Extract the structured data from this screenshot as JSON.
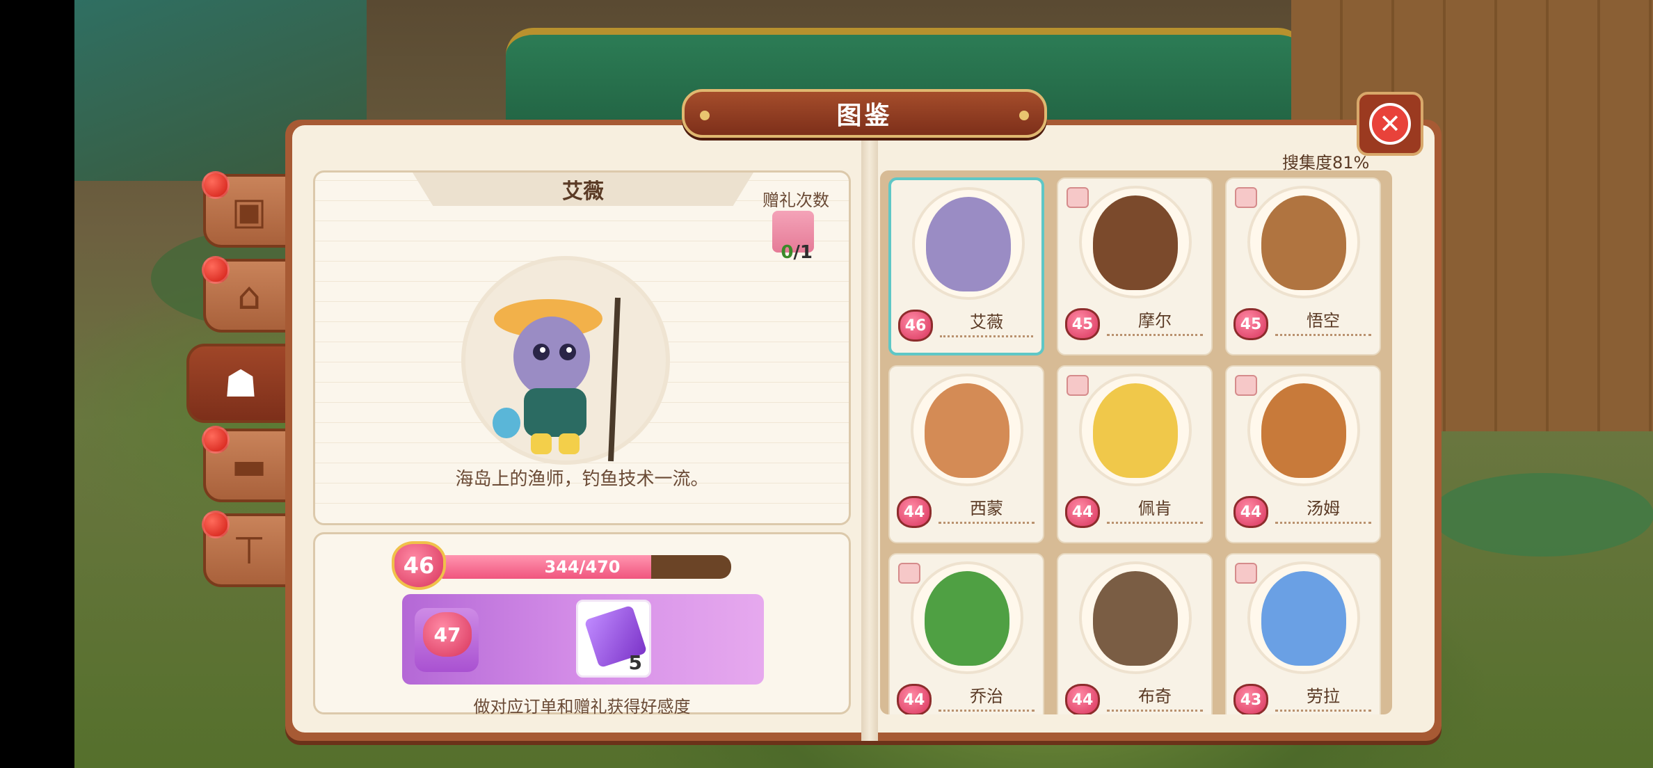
{
  "title": "图鉴",
  "close_icon": "close-icon",
  "side_tabs": [
    {
      "icon": "box-icon",
      "glyph": "▣",
      "badge": true
    },
    {
      "icon": "house-icon",
      "glyph": "⌂",
      "badge": true
    },
    {
      "icon": "owl-icon",
      "glyph": "☗",
      "badge": false,
      "active": true
    },
    {
      "icon": "sofa-icon",
      "glyph": "▬",
      "badge": true
    },
    {
      "icon": "shirt-icon",
      "glyph": "⊤",
      "badge": true
    }
  ],
  "detail": {
    "name": "艾薇",
    "gift_label": "赠礼次数",
    "gift_current": "0",
    "gift_total": "/1",
    "description": "海岛上的渔师，钓鱼技术一流。"
  },
  "level": {
    "current": "46",
    "progress_text": "344/470",
    "progress_fraction": 0.732,
    "reward_level": "47",
    "reward_qty": "5",
    "hint": "做对应订单和赠礼获得好感度"
  },
  "collection": {
    "label": "搜集度81%"
  },
  "characters": [
    {
      "name": "艾薇",
      "level": "46",
      "color": "#9a8cc4",
      "gift": false,
      "selected": true
    },
    {
      "name": "摩尔",
      "level": "45",
      "color": "#7b4a2c",
      "gift": true
    },
    {
      "name": "悟空",
      "level": "45",
      "color": "#b07440",
      "gift": true
    },
    {
      "name": "西蒙",
      "level": "44",
      "color": "#d48b55",
      "gift": false
    },
    {
      "name": "佩肯",
      "level": "44",
      "color": "#f0c84a",
      "gift": true
    },
    {
      "name": "汤姆",
      "level": "44",
      "color": "#c87a3a",
      "gift": true
    },
    {
      "name": "乔治",
      "level": "44",
      "color": "#4fa043",
      "gift": true
    },
    {
      "name": "布奇",
      "level": "44",
      "color": "#7a5d44",
      "gift": false
    },
    {
      "name": "劳拉",
      "level": "43",
      "color": "#6aa0e4",
      "gift": true
    }
  ]
}
